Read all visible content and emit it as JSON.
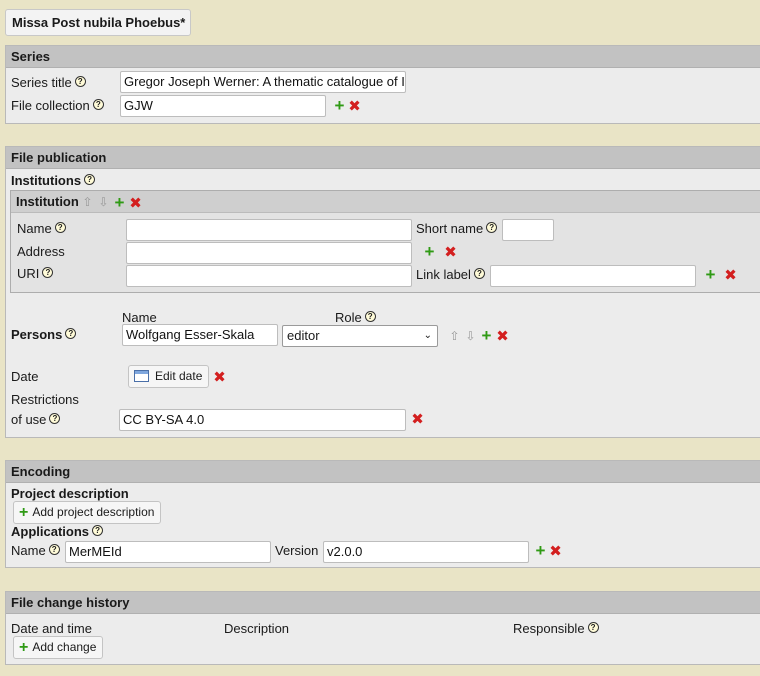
{
  "tab": {
    "title": "Missa Post nubila Phoebus*"
  },
  "series": {
    "heading": "Series",
    "title_label": "Series title",
    "title_value": "Gregor Joseph Werner: A thematic catalogue of I",
    "collection_label": "File collection",
    "collection_value": "GJW"
  },
  "publication": {
    "heading": "File publication",
    "institutions_label": "Institutions",
    "institution": {
      "heading": "Institution",
      "name_label": "Name",
      "name_value": "",
      "short_name_label": "Short name",
      "short_name_value": "",
      "address_label": "Address",
      "address_value": "",
      "uri_label": "URI",
      "uri_value": "",
      "link_label": "Link label",
      "link_value": ""
    },
    "persons_label": "Persons",
    "col_name": "Name",
    "col_role": "Role",
    "person_name": "Wolfgang Esser-Skala",
    "person_role": "editor",
    "date_label": "Date",
    "edit_date_button": "Edit date",
    "restrictions_label_1": "Restrictions",
    "restrictions_label_2": "of use",
    "restrictions_value": "CC BY-SA 4.0"
  },
  "encoding": {
    "heading": "Encoding",
    "project_desc_label": "Project description",
    "add_project_desc_button": "Add project description",
    "applications_label": "Applications",
    "name_label": "Name",
    "name_value": "MerMEId",
    "version_label": "Version",
    "version_value": "v2.0.0"
  },
  "history": {
    "heading": "File change history",
    "col_date": "Date and time",
    "col_description": "Description",
    "col_responsible": "Responsible",
    "add_change_button": "Add change"
  },
  "colors": {
    "background": "#e9e4c6",
    "panel": "#ececec",
    "header": "#c2c2c2",
    "add": "#2f9a14",
    "delete": "#d31f1f"
  }
}
